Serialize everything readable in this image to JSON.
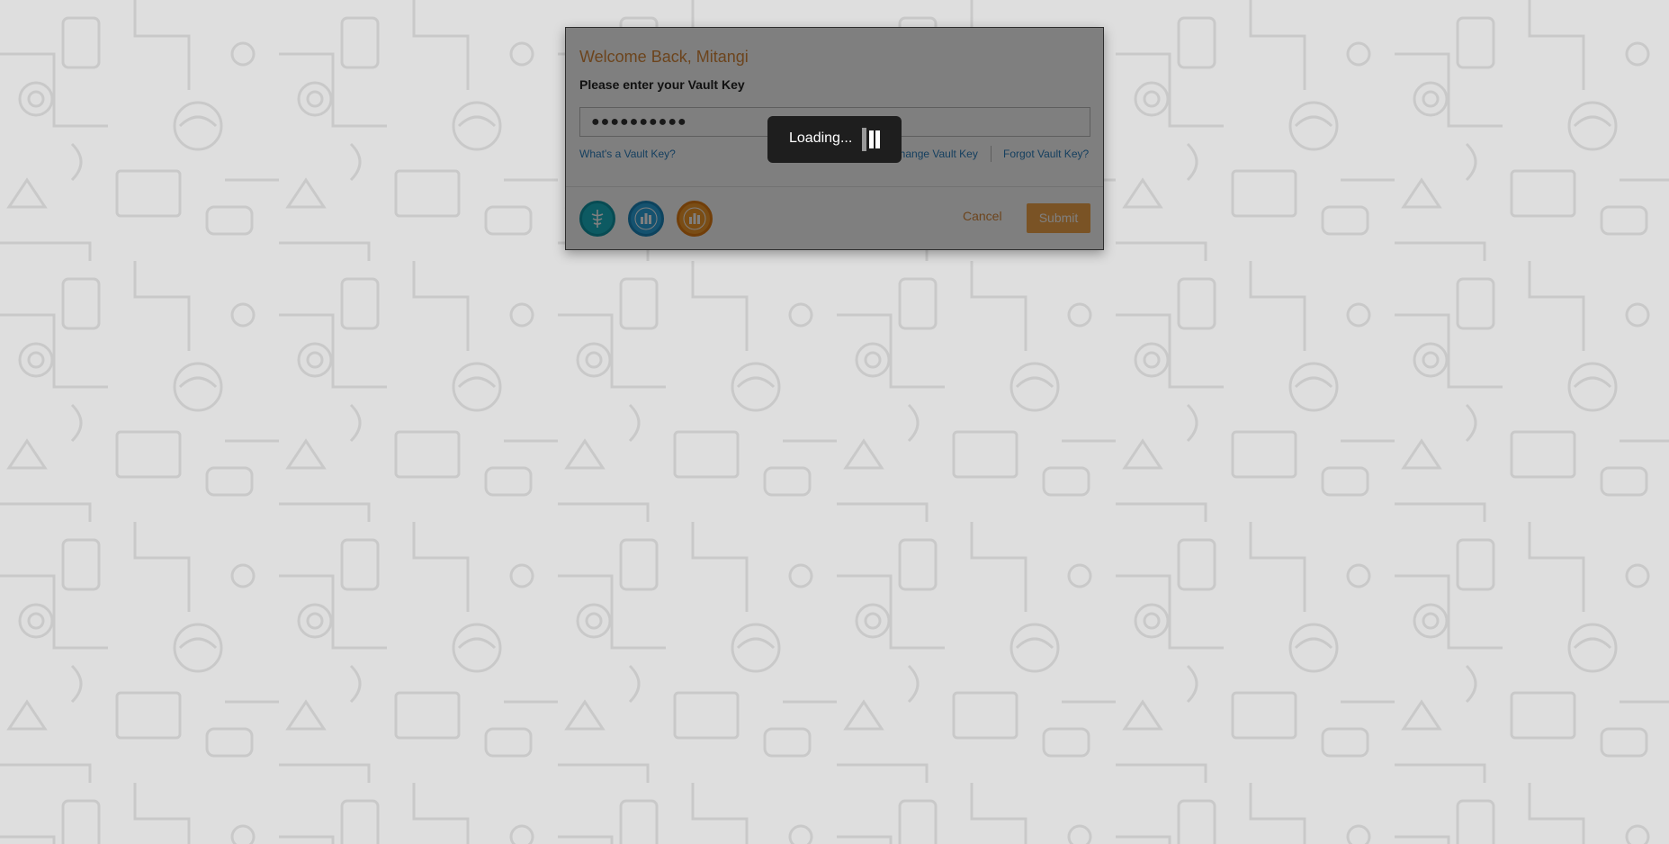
{
  "dialog": {
    "title": "Welcome Back, Mitangi",
    "subtitle": "Please enter your Vault Key",
    "vault_key_value": "●●●●●●●●●●",
    "links": {
      "whats_vault_key": "What's a Vault Key?",
      "change_vault_key": "Change Vault Key",
      "forgot_vault_key": "Forgot Vault Key?"
    },
    "badges": [
      {
        "icon": "caduceus-badge-icon",
        "color": "#1bb4c4"
      },
      {
        "icon": "chart-badge-icon",
        "color": "#2aa4df"
      },
      {
        "icon": "chart-badge-icon",
        "color": "#f59a2b"
      }
    ],
    "cancel_label": "Cancel",
    "submit_label": "Submit"
  },
  "loading": {
    "text": "Loading..."
  },
  "colors": {
    "accent": "#d9893a",
    "link": "#2a7fbf",
    "submit_bg": "#f5a64b",
    "page_bg": "#dedede"
  }
}
